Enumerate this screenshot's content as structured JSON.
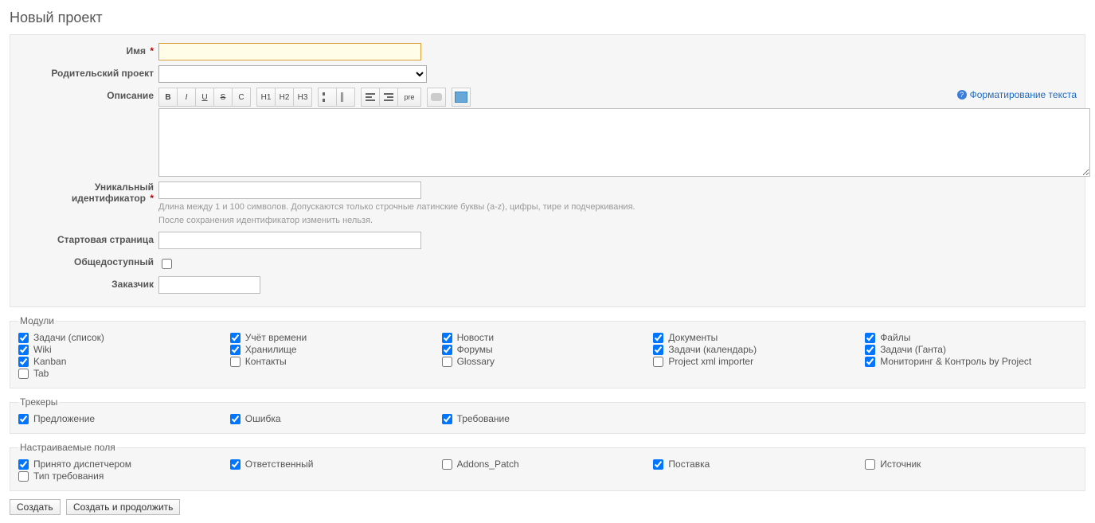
{
  "page_title": "Новый проект",
  "labels": {
    "name": "Имя",
    "parent": "Родительский проект",
    "description": "Описание",
    "identifier_l1": "Уникальный",
    "identifier_l2": "идентификатор",
    "homepage": "Стартовая страница",
    "public": "Общедоступный",
    "customer": "Заказчик"
  },
  "values": {
    "name": "",
    "parent": "",
    "description": "",
    "identifier": "",
    "homepage": "",
    "public": false,
    "customer": ""
  },
  "help_link": "Форматирование текста",
  "identifier_hint_l1": "Длина между 1 и 100 символов. Допускаются только строчные латинские буквы (a-z), цифры, тире и подчеркивания.",
  "identifier_hint_l2": "После сохранения идентификатор изменить нельзя.",
  "toolbar": {
    "bold": "B",
    "italic": "I",
    "underline": "U",
    "strike": "S",
    "code": "C",
    "h1": "H1",
    "h2": "H2",
    "h3": "H3",
    "pre": "pre"
  },
  "sections": {
    "modules": {
      "legend": "Модули",
      "columns": [
        [
          {
            "label": "Задачи (список)",
            "checked": true
          },
          {
            "label": "Wiki",
            "checked": true
          },
          {
            "label": "Kanban",
            "checked": true
          },
          {
            "label": "Tab",
            "checked": false
          }
        ],
        [
          {
            "label": "Учёт времени",
            "checked": true
          },
          {
            "label": "Хранилище",
            "checked": true
          },
          {
            "label": "Контакты",
            "checked": false
          }
        ],
        [
          {
            "label": "Новости",
            "checked": true
          },
          {
            "label": "Форумы",
            "checked": true
          },
          {
            "label": "Glossary",
            "checked": false
          }
        ],
        [
          {
            "label": "Документы",
            "checked": true
          },
          {
            "label": "Задачи (календарь)",
            "checked": true
          },
          {
            "label": "Project xml importer",
            "checked": false
          }
        ],
        [
          {
            "label": "Файлы",
            "checked": true
          },
          {
            "label": "Задачи (Ганта)",
            "checked": true
          },
          {
            "label": "Мониторинг & Контроль by Project",
            "checked": true
          }
        ]
      ]
    },
    "trackers": {
      "legend": "Трекеры",
      "columns": [
        [
          {
            "label": "Предложение",
            "checked": true
          }
        ],
        [
          {
            "label": "Ошибка",
            "checked": true
          }
        ],
        [
          {
            "label": "Требование",
            "checked": true
          }
        ],
        [],
        []
      ]
    },
    "custom_fields": {
      "legend": "Настраиваемые поля",
      "columns": [
        [
          {
            "label": "Принято диспетчером",
            "checked": true
          },
          {
            "label": "Тип требования",
            "checked": false
          }
        ],
        [
          {
            "label": "Ответственный",
            "checked": true
          }
        ],
        [
          {
            "label": "Addons_Patch",
            "checked": false
          }
        ],
        [
          {
            "label": "Поставка",
            "checked": true
          }
        ],
        [
          {
            "label": "Источник",
            "checked": false
          }
        ]
      ]
    }
  },
  "buttons": {
    "create": "Создать",
    "create_continue": "Создать и продолжить"
  }
}
